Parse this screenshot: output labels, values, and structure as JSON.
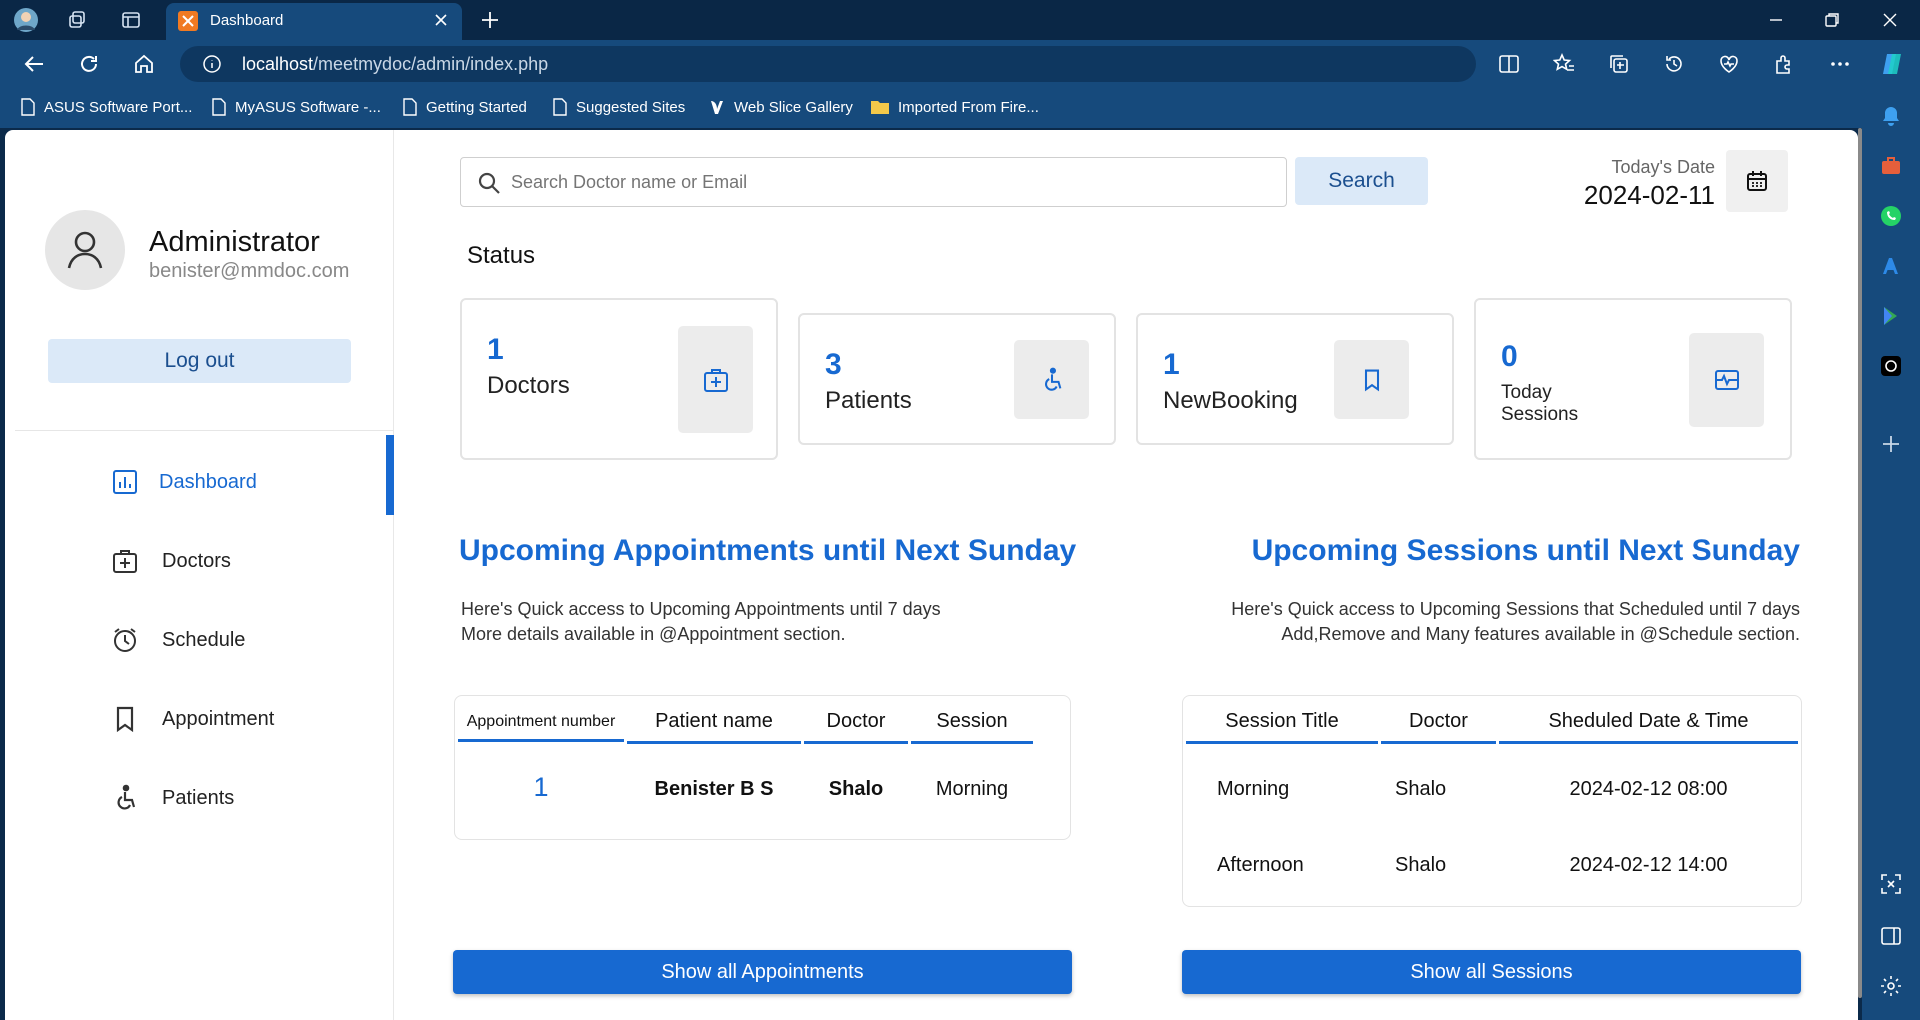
{
  "browser": {
    "tab_title": "Dashboard",
    "url_host": "localhost",
    "url_path": "/meetmydoc/admin/index.php",
    "favorites": [
      {
        "label": "ASUS Software Port...",
        "icon": "page-icon"
      },
      {
        "label": "MyASUS Software -...",
        "icon": "page-icon"
      },
      {
        "label": "Getting Started",
        "icon": "page-icon"
      },
      {
        "label": "Suggested Sites",
        "icon": "page-icon"
      },
      {
        "label": "Web Slice Gallery",
        "icon": "web-slice-icon"
      },
      {
        "label": "Imported From Fire...",
        "icon": "folder-icon"
      }
    ]
  },
  "profile": {
    "name": "Administrator",
    "email": "benister@mmdoc.com",
    "logout_label": "Log out"
  },
  "nav": {
    "items": [
      {
        "label": "Dashboard",
        "icon": "dashboard-icon",
        "active": true
      },
      {
        "label": "Doctors",
        "icon": "doctor-bag-icon",
        "active": false
      },
      {
        "label": "Schedule",
        "icon": "alarm-clock-icon",
        "active": false
      },
      {
        "label": "Appointment",
        "icon": "bookmark-icon",
        "active": false
      },
      {
        "label": "Patients",
        "icon": "wheelchair-icon",
        "active": false
      }
    ]
  },
  "search": {
    "placeholder": "Search Doctor name or Email",
    "button_label": "Search"
  },
  "date": {
    "label": "Today's Date",
    "value": "2024-02-11"
  },
  "status": {
    "title": "Status",
    "cards": [
      {
        "count": "1",
        "label": "Doctors",
        "icon": "doctor-bag-icon"
      },
      {
        "count": "3",
        "label": "Patients",
        "icon": "wheelchair-icon"
      },
      {
        "count": "1",
        "label": "NewBooking",
        "icon": "bookmark-icon"
      },
      {
        "count": "0",
        "label_line1": "Today",
        "label_line2": "Sessions",
        "icon": "session-icon"
      }
    ]
  },
  "appointments": {
    "title": "Upcoming Appointments until Next Sunday",
    "desc_line1": "Here's Quick access to Upcoming Appointments until 7 days",
    "desc_line2": "More details available in @Appointment section.",
    "columns": [
      "Appointment number",
      "Patient name",
      "Doctor",
      "Session"
    ],
    "rows": [
      {
        "number": "1",
        "patient": "Benister B S",
        "doctor": "Shalo",
        "session": "Morning"
      }
    ],
    "button_label": "Show all Appointments"
  },
  "sessions": {
    "title": "Upcoming Sessions until Next Sunday",
    "desc_line1": "Here's Quick access to Upcoming Sessions that Scheduled until 7 days",
    "desc_line2": "Add,Remove and Many features available in @Schedule section.",
    "columns": [
      "Session Title",
      "Doctor",
      "Sheduled Date & Time"
    ],
    "rows": [
      {
        "title": "Morning",
        "doctor": "Shalo",
        "datetime": "2024-02-12 08:00"
      },
      {
        "title": "Afternoon",
        "doctor": "Shalo",
        "datetime": "2024-02-12 14:00"
      }
    ],
    "button_label": "Show all Sessions"
  },
  "colors": {
    "accent": "#1769d1",
    "light_button": "#dbe9f8",
    "chrome_dark": "#0a2746",
    "chrome": "#164a7c"
  }
}
